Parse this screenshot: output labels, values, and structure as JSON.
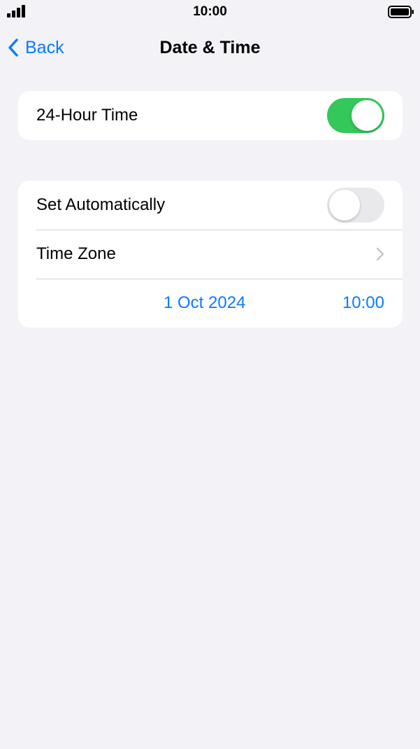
{
  "status_bar": {
    "time": "10:00",
    "signal_icon": "cellular-signal-icon",
    "battery_icon": "battery-full-icon"
  },
  "nav": {
    "back_label": "Back",
    "title": "Date & Time",
    "back_icon": "chevron-left-icon"
  },
  "group1": {
    "hour24_label": "24-Hour Time",
    "hour24_on": true
  },
  "group2": {
    "auto_label": "Set Automatically",
    "auto_on": false,
    "timezone_label": "Time Zone",
    "timezone_icon": "chevron-right-icon",
    "date_value": "1 Oct 2024",
    "time_value": "10:00"
  },
  "colors": {
    "accent": "#0a7aff",
    "toggle_on": "#34c759",
    "toggle_off": "#e9e9eb",
    "background": "#f2f2f7"
  }
}
